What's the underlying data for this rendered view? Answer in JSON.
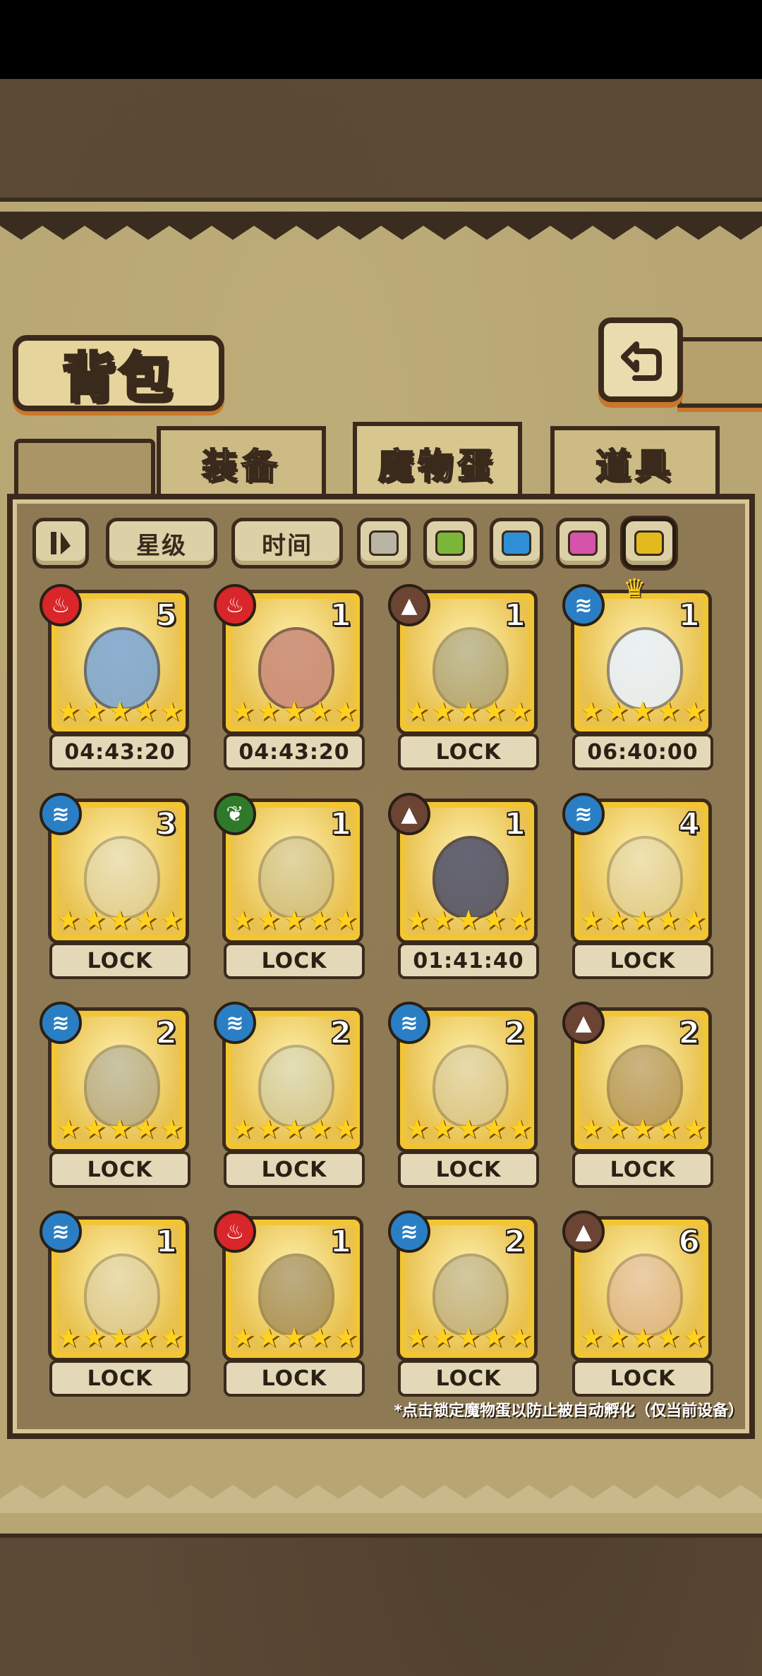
{
  "header": {
    "title": "背包"
  },
  "tabs": [
    {
      "label": "装备",
      "active": false
    },
    {
      "label": "魔物蛋",
      "active": true
    },
    {
      "label": "道具",
      "active": false
    }
  ],
  "filters": {
    "sort_icon": "sort-toggle-icon",
    "star_label": "星级",
    "time_label": "时间",
    "colors": [
      "#b9b4a4",
      "#7bb63a",
      "#2f8fd6",
      "#d553a8",
      "#e4b91f"
    ]
  },
  "element_colors": {
    "fire": "#d8262a",
    "earth": "#6b4433",
    "water": "#2a7fc4",
    "wood": "#2f7a2a"
  },
  "items": [
    {
      "element": "fire",
      "count": "5",
      "stars": 5,
      "status": "04:43:20",
      "icon": "wizard-hat-egg-icon",
      "tint": "#7aa6d8"
    },
    {
      "element": "fire",
      "count": "1",
      "stars": 5,
      "status": "04:43:20",
      "icon": "sword-egg-icon",
      "tint": "#c9897a"
    },
    {
      "element": "earth",
      "count": "1",
      "stars": 5,
      "status": "LOCK",
      "icon": "hammer-egg-icon",
      "tint": "#7e8280"
    },
    {
      "element": "water",
      "count": "1",
      "stars": 5,
      "status": "06:40:00",
      "icon": "winged-rainbow-egg-icon",
      "tint": "#e8f2ff",
      "crown": true
    },
    {
      "element": "water",
      "count": "3",
      "stars": 5,
      "status": "LOCK",
      "icon": "skull-egg-icon",
      "tint": "#d8d2c2"
    },
    {
      "element": "wood",
      "count": "1",
      "stars": 5,
      "status": "LOCK",
      "icon": "laurel-egg-icon",
      "tint": "#bcb496"
    },
    {
      "element": "earth",
      "count": "1",
      "stars": 5,
      "status": "01:41:40",
      "icon": "dark-cloud-egg-icon",
      "tint": "#4b4d6a"
    },
    {
      "element": "water",
      "count": "4",
      "stars": 5,
      "status": "LOCK",
      "icon": "vine-egg-icon",
      "tint": "#d9d1b6"
    },
    {
      "element": "water",
      "count": "2",
      "stars": 5,
      "status": "LOCK",
      "icon": "feather-egg-icon",
      "tint": "#8b8f9c"
    },
    {
      "element": "water",
      "count": "2",
      "stars": 5,
      "status": "LOCK",
      "icon": "bow-egg-icon",
      "tint": "#bfc7c0"
    },
    {
      "element": "water",
      "count": "2",
      "stars": 5,
      "status": "LOCK",
      "icon": "heart-banner-egg-icon",
      "tint": "#cbc1a8"
    },
    {
      "element": "earth",
      "count": "2",
      "stars": 5,
      "status": "LOCK",
      "icon": "beetle-egg-icon",
      "tint": "#8b6a4a"
    },
    {
      "element": "water",
      "count": "1",
      "stars": 5,
      "status": "LOCK",
      "icon": "angel-egg-icon",
      "tint": "#cfc7b2"
    },
    {
      "element": "fire",
      "count": "1",
      "stars": 5,
      "status": "LOCK",
      "icon": "horned-egg-icon",
      "tint": "#6b5a4a"
    },
    {
      "element": "water",
      "count": "2",
      "stars": 5,
      "status": "LOCK",
      "icon": "cross-egg-icon",
      "tint": "#9c9890"
    },
    {
      "element": "earth",
      "count": "6",
      "stars": 5,
      "status": "LOCK",
      "icon": "heart-egg-icon",
      "tint": "#d4a3a0"
    }
  ],
  "footnote": "*点击锁定魔物蛋以防止被自动孵化（仅当前设备）"
}
